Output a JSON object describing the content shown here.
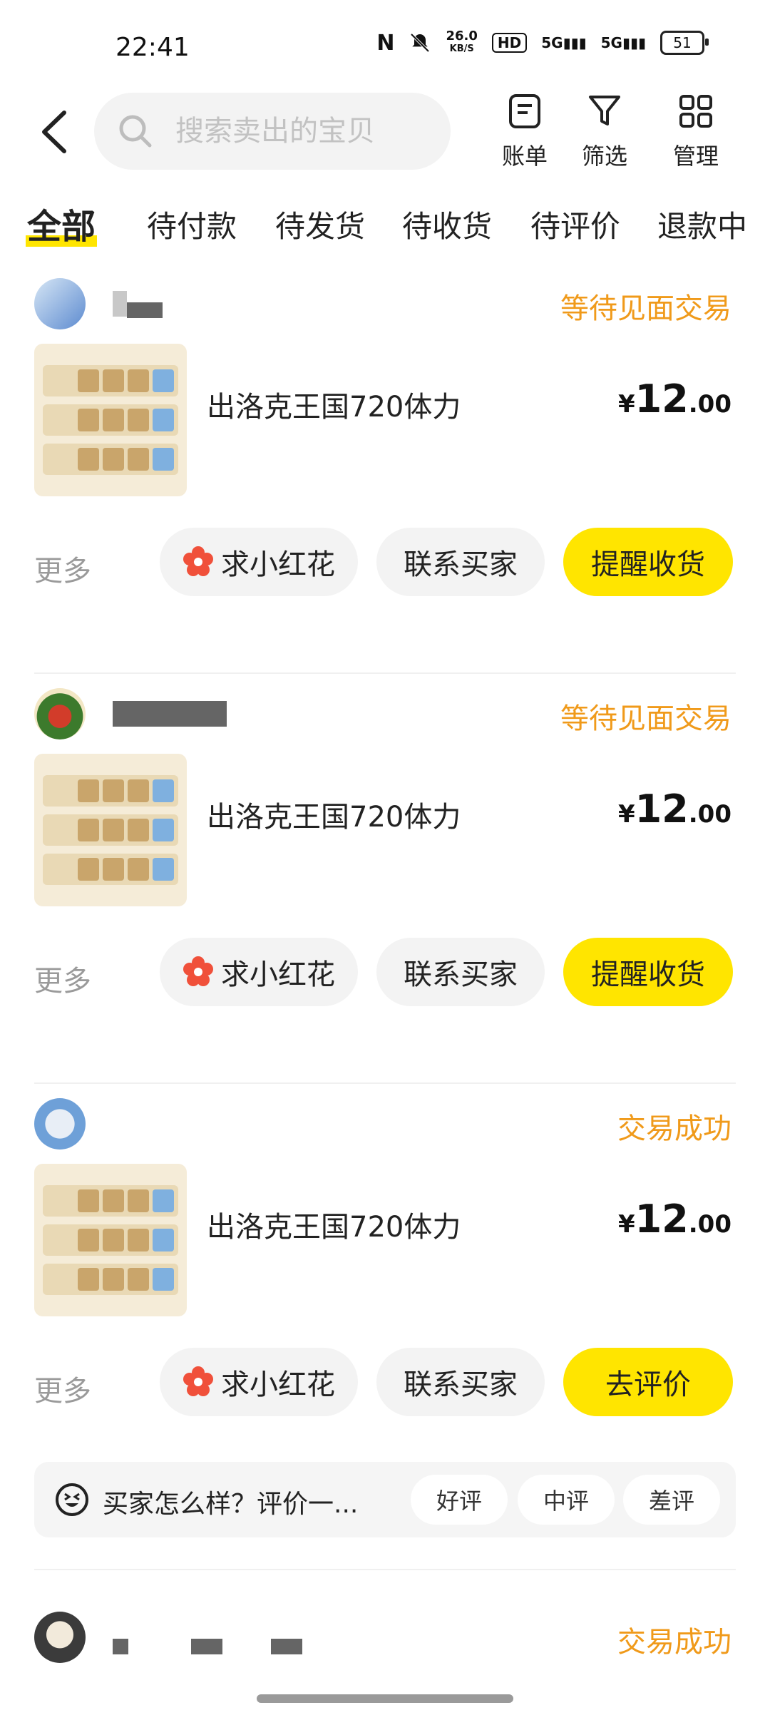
{
  "status_bar": {
    "time": "22:41",
    "net_speed": "26.0",
    "net_unit": "KB/S",
    "hd": "HD",
    "signal1": "5G",
    "signal2": "5G",
    "battery": "51"
  },
  "header": {
    "search_placeholder": "搜索卖出的宝贝",
    "buttons": [
      {
        "label": "账单",
        "icon": "bill-icon"
      },
      {
        "label": "筛选",
        "icon": "filter-icon"
      },
      {
        "label": "管理",
        "icon": "grid-icon"
      }
    ]
  },
  "tabs": [
    "全部",
    "待付款",
    "待发货",
    "待收货",
    "待评价",
    "退款中"
  ],
  "orders": [
    {
      "status": "等待见面交易",
      "title": "出洛克王国720体力",
      "price_currency": "¥",
      "price_int": "12",
      "price_dec": ".00",
      "more": "更多",
      "btn1": "求小红花",
      "btn2": "联系买家",
      "btn3": "提醒收货"
    },
    {
      "status": "等待见面交易",
      "title": "出洛克王国720体力",
      "price_currency": "¥",
      "price_int": "12",
      "price_dec": ".00",
      "more": "更多",
      "btn1": "求小红花",
      "btn2": "联系买家",
      "btn3": "提醒收货"
    },
    {
      "status": "交易成功",
      "title": "出洛克王国720体力",
      "price_currency": "¥",
      "price_int": "12",
      "price_dec": ".00",
      "more": "更多",
      "btn1": "求小红花",
      "btn2": "联系买家",
      "btn3": "去评价"
    },
    {
      "status": "交易成功"
    }
  ],
  "review_prompt": {
    "question": "买家怎么样？评价一...",
    "options": [
      "好评",
      "中评",
      "差评"
    ]
  },
  "colors": {
    "accent_yellow": "#ffe500",
    "status_orange": "#f09a1a"
  }
}
